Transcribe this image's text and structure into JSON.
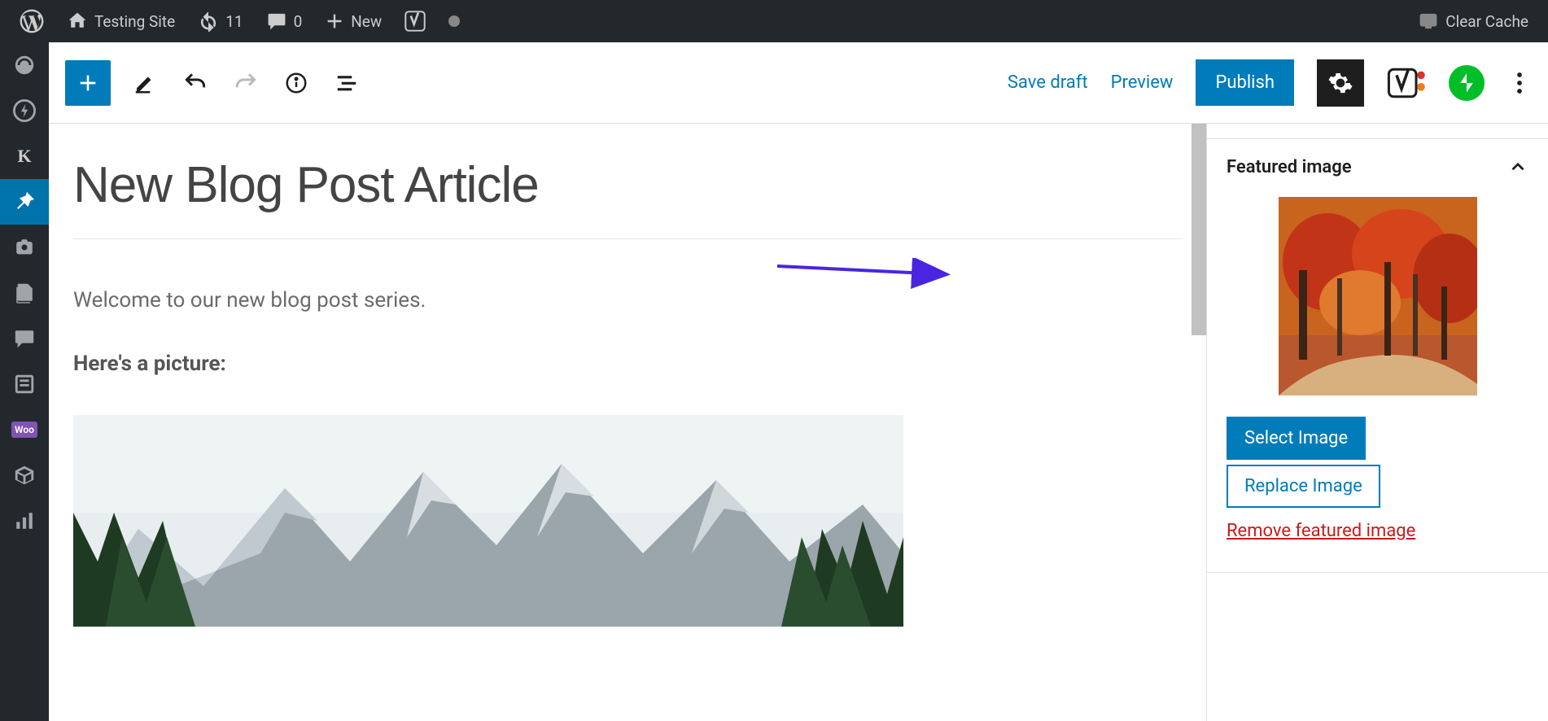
{
  "adminbar": {
    "site_name": "Testing Site",
    "updates_count": "11",
    "comments_count": "0",
    "new_label": "New",
    "clear_cache": "Clear Cache"
  },
  "toolbar": {
    "save_draft": "Save draft",
    "preview": "Preview",
    "publish": "Publish"
  },
  "post": {
    "title": "New Blog Post Article",
    "paragraph1": "Welcome to our new blog post series.",
    "paragraph2": "Here's a picture:"
  },
  "sidebar": {
    "featured_image": {
      "title": "Featured image",
      "select": "Select Image",
      "replace": "Replace Image",
      "remove": "Remove featured image"
    }
  },
  "left_menu": {
    "k_letter": "K",
    "woo": "Woo"
  }
}
